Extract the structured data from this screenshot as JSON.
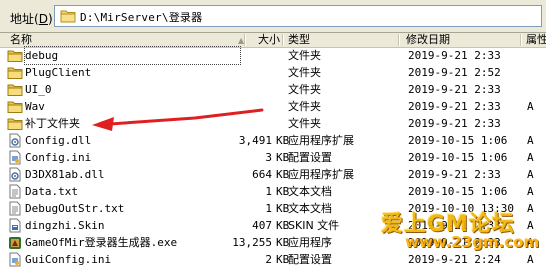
{
  "address_bar": {
    "label": "地址",
    "shortcut": "D",
    "path": "D:\\MirServer\\登录器"
  },
  "columns": {
    "name": "名称",
    "size": "大小",
    "type": "类型",
    "modified": "修改日期",
    "attributes": "属性"
  },
  "files": [
    {
      "name": "debug",
      "size": "",
      "unit": "",
      "type": "文件夹",
      "date": "2019-9-21 2:33",
      "attr": "",
      "icon": "folder-icon"
    },
    {
      "name": "PlugClient",
      "size": "",
      "unit": "",
      "type": "文件夹",
      "date": "2019-9-21 2:52",
      "attr": "",
      "icon": "folder-icon"
    },
    {
      "name": "UI_0",
      "size": "",
      "unit": "",
      "type": "文件夹",
      "date": "2019-9-21 2:33",
      "attr": "",
      "icon": "folder-icon"
    },
    {
      "name": "Wav",
      "size": "",
      "unit": "",
      "type": "文件夹",
      "date": "2019-9-21 2:33",
      "attr": "A",
      "icon": "folder-icon"
    },
    {
      "name": "补丁文件夹",
      "size": "",
      "unit": "",
      "type": "文件夹",
      "date": "2019-9-21 2:33",
      "attr": "",
      "icon": "folder-icon"
    },
    {
      "name": "Config.dll",
      "size": "3,491",
      "unit": "KB",
      "type": "应用程序扩展",
      "date": "2019-10-15 1:06",
      "attr": "A",
      "icon": "dll-icon"
    },
    {
      "name": "Config.ini",
      "size": "3",
      "unit": "KB",
      "type": "配置设置",
      "date": "2019-10-15 1:06",
      "attr": "A",
      "icon": "ini-icon"
    },
    {
      "name": "D3DX81ab.dll",
      "size": "664",
      "unit": "KB",
      "type": "应用程序扩展",
      "date": "2019-9-21 2:33",
      "attr": "A",
      "icon": "dll-icon"
    },
    {
      "name": "Data.txt",
      "size": "1",
      "unit": "KB",
      "type": "文本文档",
      "date": "2019-10-15 1:06",
      "attr": "A",
      "icon": "txt-icon"
    },
    {
      "name": "DebugOutStr.txt",
      "size": "1",
      "unit": "KB",
      "type": "文本文档",
      "date": "2019-10-10 13:30",
      "attr": "A",
      "icon": "txt-icon"
    },
    {
      "name": "dingzhi.Skin",
      "size": "407",
      "unit": "KB",
      "type": "SKIN 文件",
      "date": "2019-9-21 2:33",
      "attr": "A",
      "icon": "skin-icon"
    },
    {
      "name": "GameOfMir登录器生成器.exe",
      "size": "13,255",
      "unit": "KB",
      "type": "应用程序",
      "date": "2019-9-21 2:33",
      "attr": "A",
      "icon": "exe-icon"
    },
    {
      "name": "GuiConfig.ini",
      "size": "2",
      "unit": "KB",
      "type": "配置设置",
      "date": "2019-9-21 2:24",
      "attr": "A",
      "icon": "ini-icon"
    }
  ],
  "watermark": {
    "line1": "爱上GM论坛",
    "line2": "www.23gm.com"
  },
  "colors": {
    "folder": "#f3d46a",
    "arrow": "#e02020",
    "chrome": "#ece9d8",
    "watermark": "#f0b400"
  }
}
